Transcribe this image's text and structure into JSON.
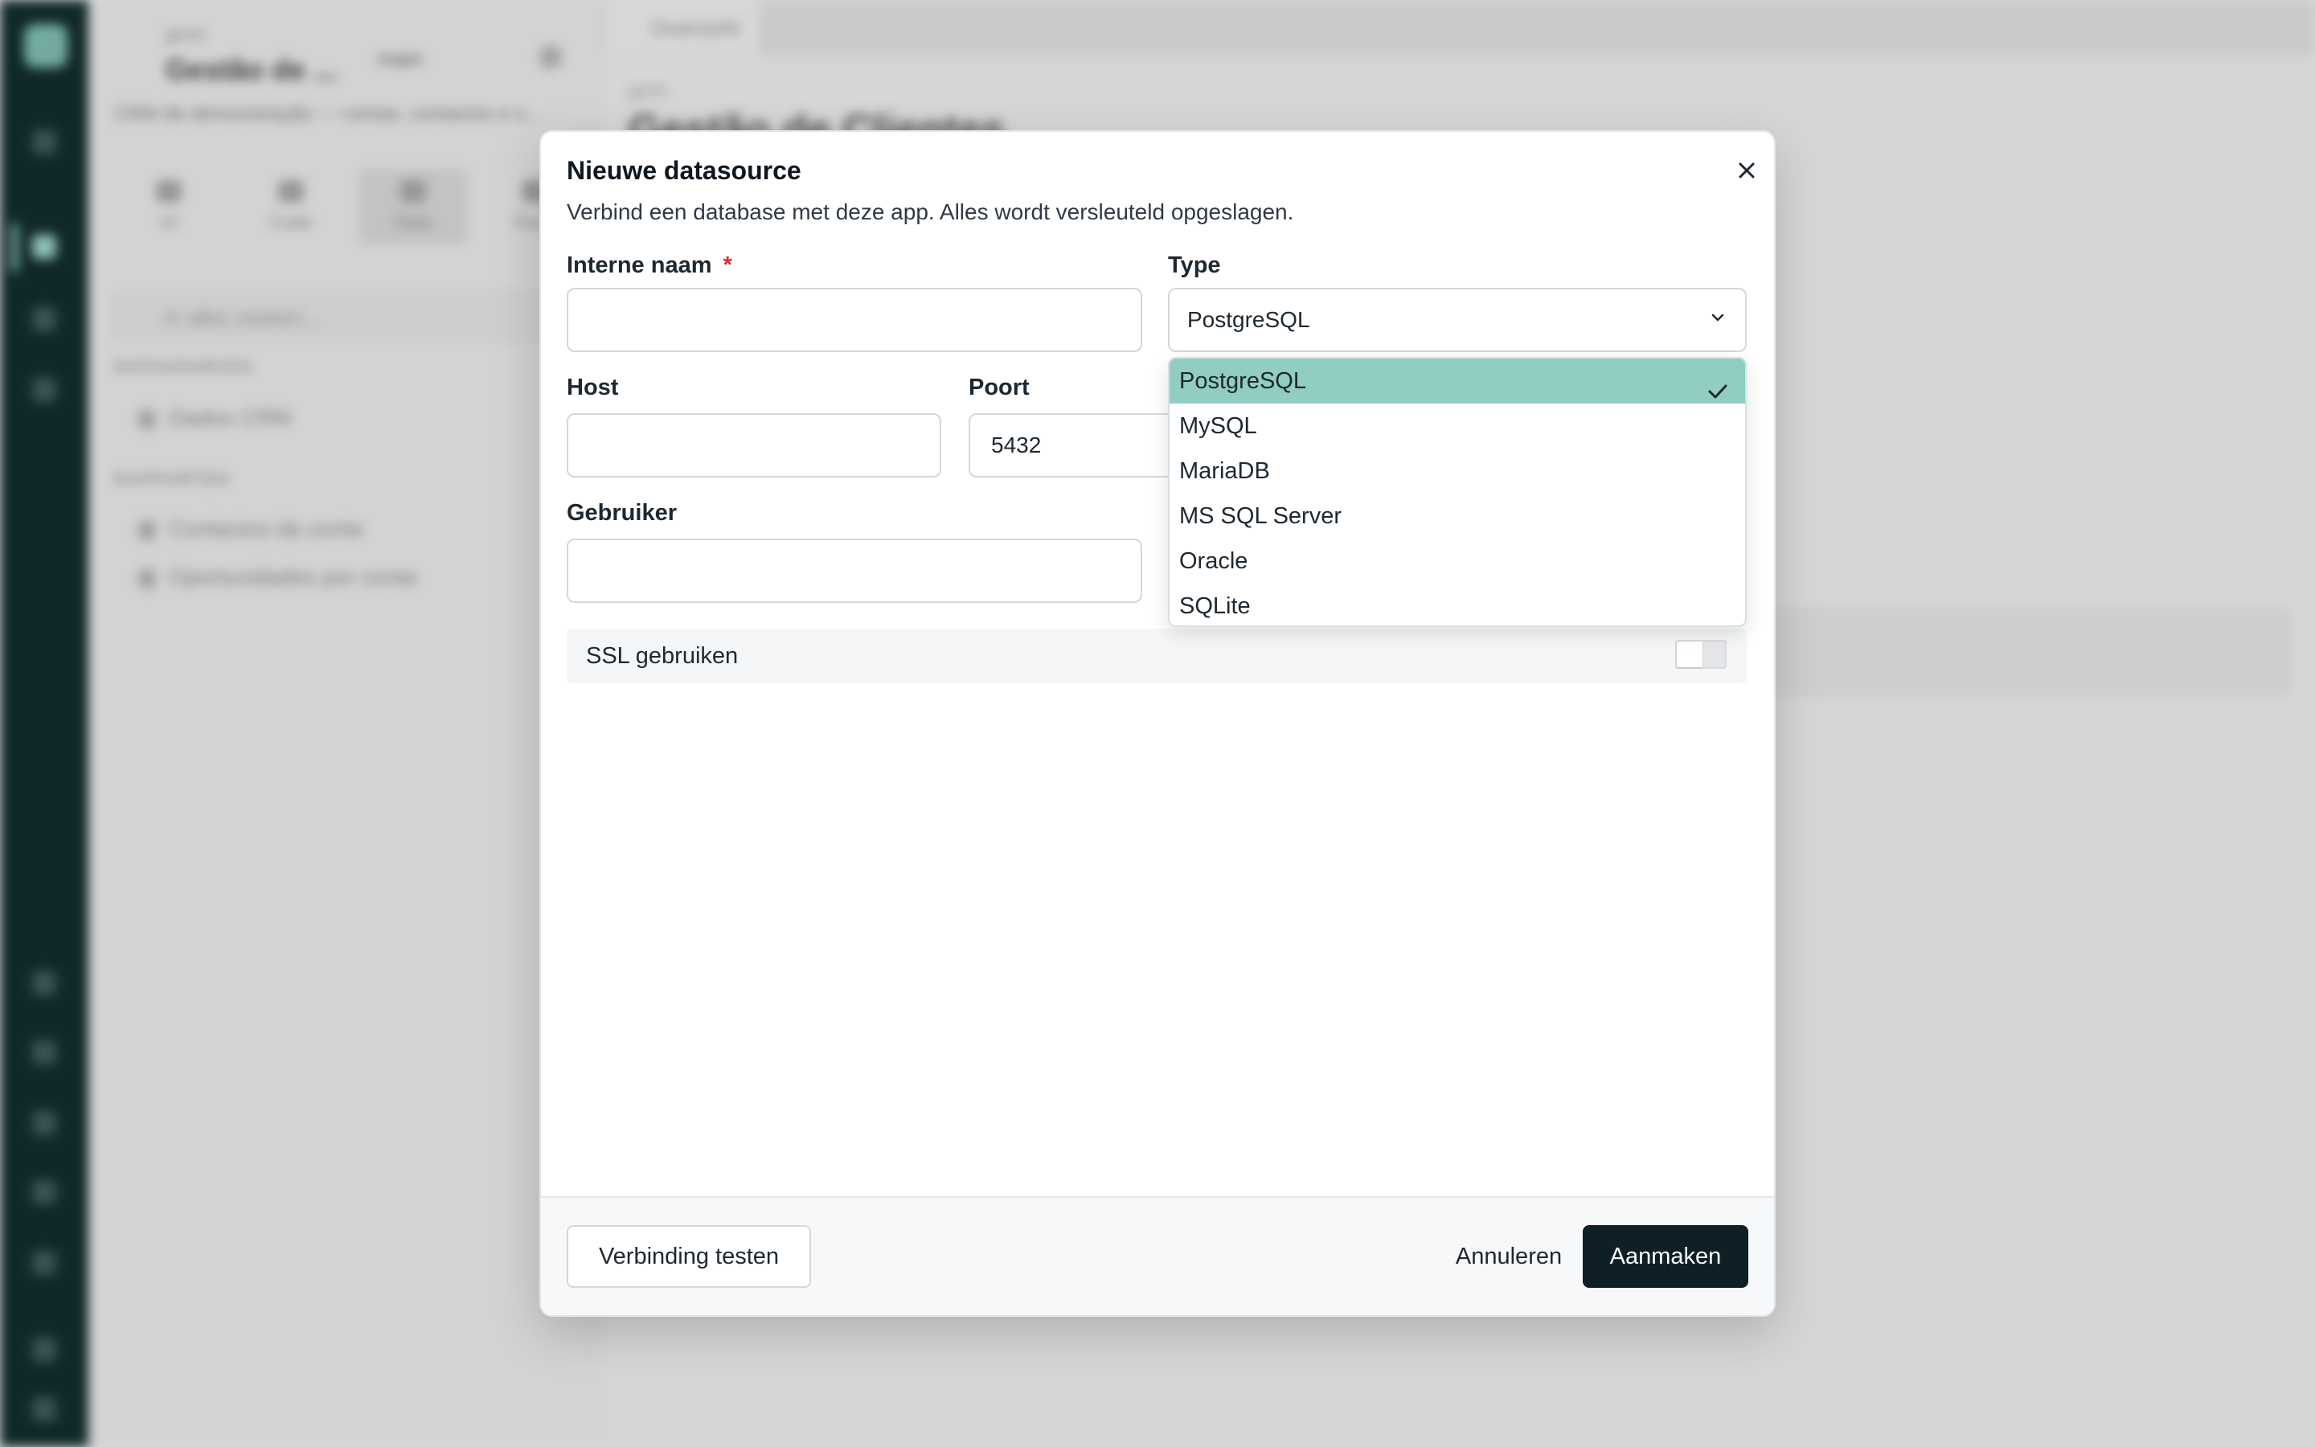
{
  "background": {
    "panel_small": "gcrm",
    "panel_title": "Gestão de ...",
    "panel_branch": "main",
    "panel_subtitle": "CRM de demonstração — contas, contactos e o...",
    "panel_tabs": [
      "UI",
      "Code",
      "Data",
      "Runs"
    ],
    "search_placeholder": "In alles zoeken...",
    "section_datasources": "DATASOURCES",
    "datasource_item": "Dados CRM",
    "section_reports": "RAPPORTEN",
    "report_items": [
      "Contactos da conta",
      "Oportunidades por conta"
    ],
    "main_tab": "Overzicht",
    "main_small": "gcrm",
    "main_title": "Gestão de Clientes"
  },
  "modal": {
    "title": "Nieuwe datasource",
    "description": "Verbind een database met deze app. Alles wordt versleuteld opgeslagen.",
    "fields": {
      "name_label": "Interne naam",
      "required_mark": "*",
      "name_value": "",
      "type_label": "Type",
      "type_value": "PostgreSQL",
      "host_label": "Host",
      "host_value": "",
      "port_label": "Poort",
      "port_value": "5432",
      "user_label": "Gebruiker",
      "user_value": ""
    },
    "type_options": [
      "PostgreSQL",
      "MySQL",
      "MariaDB",
      "MS SQL Server",
      "Oracle",
      "SQLite"
    ],
    "selected_option": "PostgreSQL",
    "ssl_label": "SSL gebruiken",
    "ssl_enabled": false,
    "buttons": {
      "test": "Verbinding testen",
      "cancel": "Annuleren",
      "create": "Aanmaken"
    }
  },
  "colors": {
    "accent": "#92cdc3",
    "primary_button": "#0f1f26",
    "required": "#d32f2f"
  }
}
